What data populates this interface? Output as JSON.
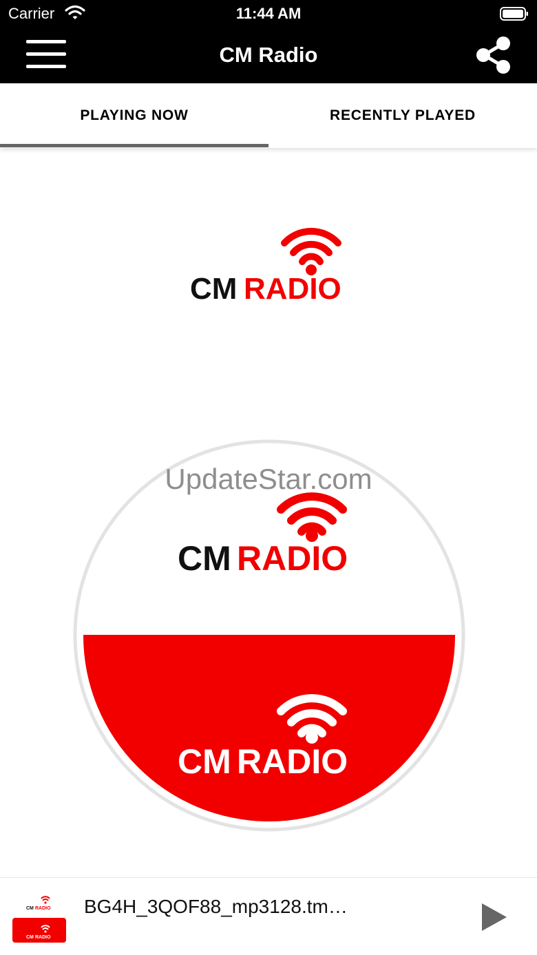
{
  "status_bar": {
    "carrier": "Carrier",
    "time": "11:44 AM"
  },
  "nav": {
    "title": "CM Radio",
    "menu_icon": "hamburger-menu-icon",
    "share_icon": "share-icon"
  },
  "tabs": [
    {
      "label": "PLAYING NOW",
      "active": true
    },
    {
      "label": "RECENTLY PLAYED",
      "active": false
    }
  ],
  "logo": {
    "text_dark": "CM",
    "text_red": "RADIO"
  },
  "watermark": "UpdateStar.com",
  "player": {
    "track": "BG4H_3QOF88_mp3128.tm…",
    "play_icon": "play-icon"
  },
  "colors": {
    "brand_red": "#F20000",
    "bar_black": "#000000",
    "tab_indicator": "#666666"
  }
}
